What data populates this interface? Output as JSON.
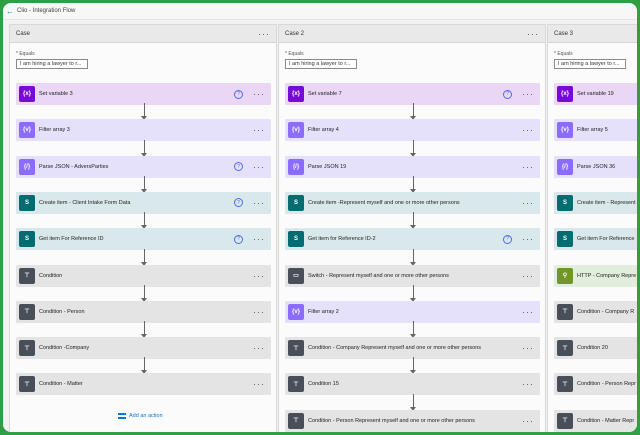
{
  "header": {
    "breadcrumb": "Clio - Integration Flow"
  },
  "columns": [
    {
      "title": "Case",
      "equals_label": "* Equals",
      "equals_value": "I am hiring a lawyer to r...",
      "actions": [
        {
          "label": "Set variable 3",
          "type": "var",
          "icon": "{x}",
          "info": true
        },
        {
          "label": "Filter array 3",
          "type": "data",
          "icon": "{v}",
          "info": false
        },
        {
          "label": "Parse JSON - AdversParties",
          "type": "data",
          "icon": "{/}",
          "info": true
        },
        {
          "label": "Create item - Client Intake Form Data",
          "type": "sp",
          "icon": "S",
          "info": true
        },
        {
          "label": "Get item For Reference ID",
          "type": "sp",
          "icon": "S",
          "info": true
        },
        {
          "label": "Condition",
          "type": "ctl",
          "icon": "⊤",
          "info": false
        },
        {
          "label": "Condition - Person",
          "type": "ctl",
          "icon": "⊤",
          "info": false
        },
        {
          "label": "Condition -Company",
          "type": "ctl",
          "icon": "⊤",
          "info": false
        },
        {
          "label": "Condition - Matter",
          "type": "ctl",
          "icon": "⊤",
          "info": false
        }
      ],
      "add_action": "Add an action"
    },
    {
      "title": "Case 2",
      "equals_label": "* Equals",
      "equals_value": "I am hiring a lawyer to r...",
      "actions": [
        {
          "label": "Set variable 7",
          "type": "var",
          "icon": "{x}",
          "info": true
        },
        {
          "label": "Filter array 4",
          "type": "data",
          "icon": "{v}",
          "info": false
        },
        {
          "label": "Parse JSON 19",
          "type": "data",
          "icon": "{/}",
          "info": false
        },
        {
          "label": "Create item -Represent myself and one or more other persons",
          "type": "sp",
          "icon": "S",
          "info": false
        },
        {
          "label": "Get item for Reference ID-2",
          "type": "sp",
          "icon": "S",
          "info": true
        },
        {
          "label": "Switch - Represent myself and one or more other persons",
          "type": "ctl",
          "icon": "▭",
          "info": false
        },
        {
          "label": "Filter array 2",
          "type": "data",
          "icon": "{v}",
          "info": false
        },
        {
          "label": "Condition - Company Represent myself and one or more other persons",
          "type": "ctl",
          "icon": "⊤",
          "info": false
        },
        {
          "label": "Condition 15",
          "type": "ctl",
          "icon": "⊤",
          "info": false
        },
        {
          "label": "Condition - Person Represent myself and one or more other persons",
          "type": "ctl",
          "icon": "⊤",
          "info": false
        }
      ]
    },
    {
      "title": "Case 3",
      "equals_label": "* Equals",
      "equals_value": "I am hiring a lawyer to r...",
      "actions": [
        {
          "label": "Set variable 19",
          "type": "var",
          "icon": "{x}",
          "info": false
        },
        {
          "label": "Filter array 5",
          "type": "data",
          "icon": "{v}",
          "info": false
        },
        {
          "label": "Parse JSON 36",
          "type": "data",
          "icon": "{/}",
          "info": false
        },
        {
          "label": "Create item - Represent",
          "type": "sp",
          "icon": "S",
          "info": false
        },
        {
          "label": "Get item For Reference",
          "type": "sp",
          "icon": "S",
          "info": false
        },
        {
          "label": "HTTP - Company Repre",
          "type": "http",
          "icon": "⚲",
          "info": false
        },
        {
          "label": "Condition - Company R",
          "type": "ctl",
          "icon": "⊤",
          "info": false
        },
        {
          "label": "Condition 20",
          "type": "ctl",
          "icon": "⊤",
          "info": false
        },
        {
          "label": "Condition - Person Repr",
          "type": "ctl",
          "icon": "⊤",
          "info": false
        },
        {
          "label": "Condition - Matter Repr",
          "type": "ctl",
          "icon": "⊤",
          "info": false
        }
      ]
    }
  ],
  "colors": {
    "frame_green": "#2f9e44",
    "variable": "#770bd6",
    "data_operation": "#8c6cff",
    "sharepoint": "#036c70",
    "control": "#484f58",
    "http": "#709727"
  }
}
